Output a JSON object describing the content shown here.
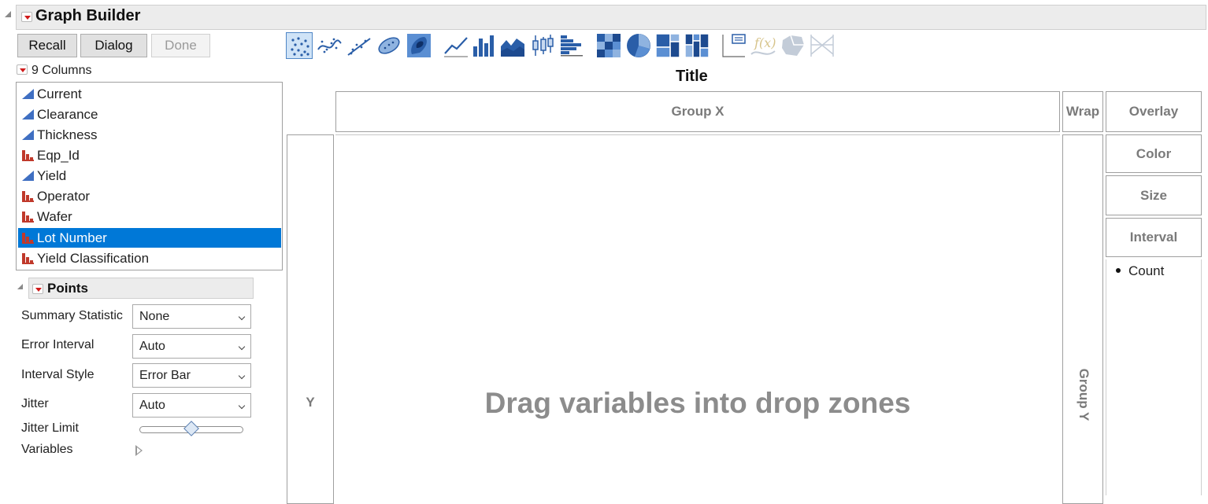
{
  "window": {
    "title": "Graph Builder"
  },
  "buttons": {
    "recall": "Recall",
    "dialog": "Dialog",
    "done": "Done"
  },
  "columns": {
    "count_label": "9 Columns",
    "items": [
      {
        "label": "Current",
        "type": "continuous"
      },
      {
        "label": "Clearance",
        "type": "continuous"
      },
      {
        "label": "Thickness",
        "type": "continuous"
      },
      {
        "label": "Eqp_Id",
        "type": "nominal"
      },
      {
        "label": "Yield",
        "type": "continuous"
      },
      {
        "label": "Operator",
        "type": "nominal"
      },
      {
        "label": "Wafer",
        "type": "nominal"
      },
      {
        "label": "Lot Number",
        "type": "nominal",
        "selected": true
      },
      {
        "label": "Yield Classification",
        "type": "nominal"
      }
    ]
  },
  "points": {
    "title": "Points",
    "summary_statistic": {
      "label": "Summary Statistic",
      "value": "None"
    },
    "error_interval": {
      "label": "Error Interval",
      "value": "Auto"
    },
    "interval_style": {
      "label": "Interval Style",
      "value": "Error Bar"
    },
    "jitter": {
      "label": "Jitter",
      "value": "Auto"
    },
    "jitter_limit": {
      "label": "Jitter Limit",
      "value": 0.5
    },
    "variables": {
      "label": "Variables"
    }
  },
  "toolbar": {
    "icons": [
      "points-icon",
      "smoother-icon",
      "line-of-fit-icon",
      "ellipse-icon",
      "contour-icon",
      "line-icon",
      "bar-icon",
      "area-icon",
      "box-plot-icon",
      "histogram-icon",
      "heatmap-icon",
      "pie-icon",
      "treemap-icon",
      "mosaic-icon",
      "caption-box-icon",
      "formula-icon",
      "map-shapes-icon",
      "parallel-plot-icon"
    ],
    "selected": "points-icon"
  },
  "graph": {
    "title": "Title",
    "group_x": "Group X",
    "wrap": "Wrap",
    "overlay": "Overlay",
    "y": "Y",
    "group_y": "Group Y",
    "color": "Color",
    "size": "Size",
    "interval": "Interval",
    "drop_hint": "Drag variables into drop zones",
    "legend_item": "Count"
  },
  "colors": {
    "accent": "#0078d7",
    "continuous_icon": "#3f6fc2",
    "nominal_icon": "#c0392b",
    "toolbar_icon": "#2a5ea8"
  }
}
